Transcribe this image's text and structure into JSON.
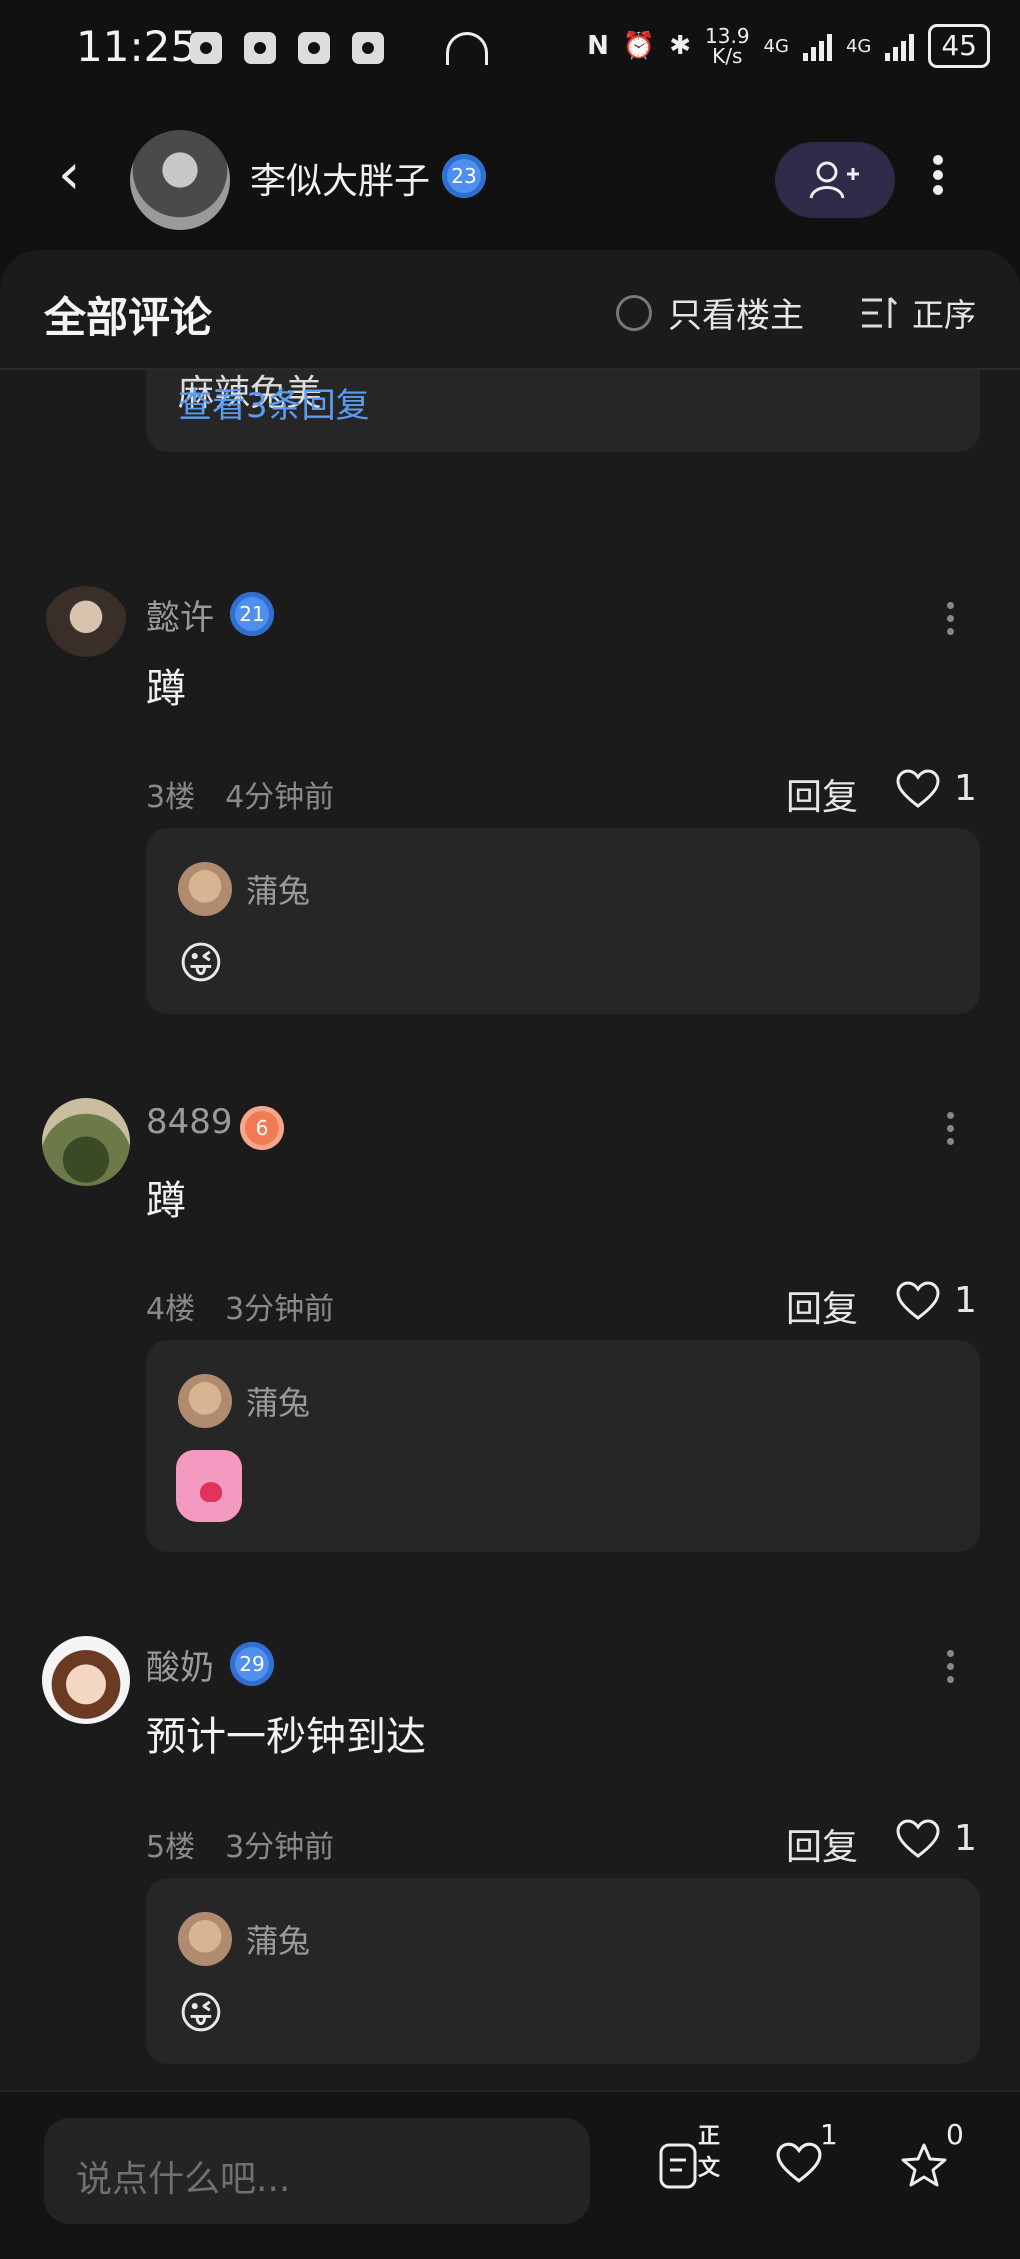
{
  "status_bar": {
    "time": "11:25",
    "net_speed_top": "13.9",
    "net_speed_bottom": "K/s",
    "net_label_1": "4G",
    "net_label_2": "4G",
    "battery": "45"
  },
  "header": {
    "author_name": "李似大胖子",
    "author_level": "23"
  },
  "sheet": {
    "title": "全部评论",
    "only_owner_label": "只看楼主",
    "sort_label": "正序"
  },
  "prev_block": {
    "cut_text": "麻辣兔美",
    "view_replies": "查看3条回复"
  },
  "comments": [
    {
      "name": "懿许",
      "level": "21",
      "level_color": "#4f8ff0",
      "text": "蹲",
      "floor": "3楼",
      "time": "4分钟前",
      "reply_label": "回复",
      "likes": "1",
      "reply": {
        "name": "蒲兔",
        "content": "😜"
      }
    },
    {
      "name": "8489",
      "level": "6",
      "level_color": "#f07a52",
      "text": "蹲",
      "floor": "4楼",
      "time": "3分钟前",
      "reply_label": "回复",
      "likes": "1",
      "reply": {
        "name": "蒲兔",
        "content": "sticker"
      }
    },
    {
      "name": "酸奶",
      "level": "29",
      "level_color": "#4f8ff0",
      "text": "预计一秒钟到达",
      "floor": "5楼",
      "time": "3分钟前",
      "reply_label": "回复",
      "likes": "1",
      "reply": {
        "name": "蒲兔",
        "content": "😜"
      }
    }
  ],
  "bottom_bar": {
    "input_placeholder": "说点什么吧...",
    "body_label": "正文",
    "like_count": "1",
    "star_count": "0"
  },
  "icons": {
    "back": "back-arrow-icon",
    "follow": "add-user-icon",
    "more": "more-vertical-icon",
    "sort": "sort-icon",
    "like": "heart-icon",
    "star": "star-icon",
    "doc": "document-icon"
  }
}
